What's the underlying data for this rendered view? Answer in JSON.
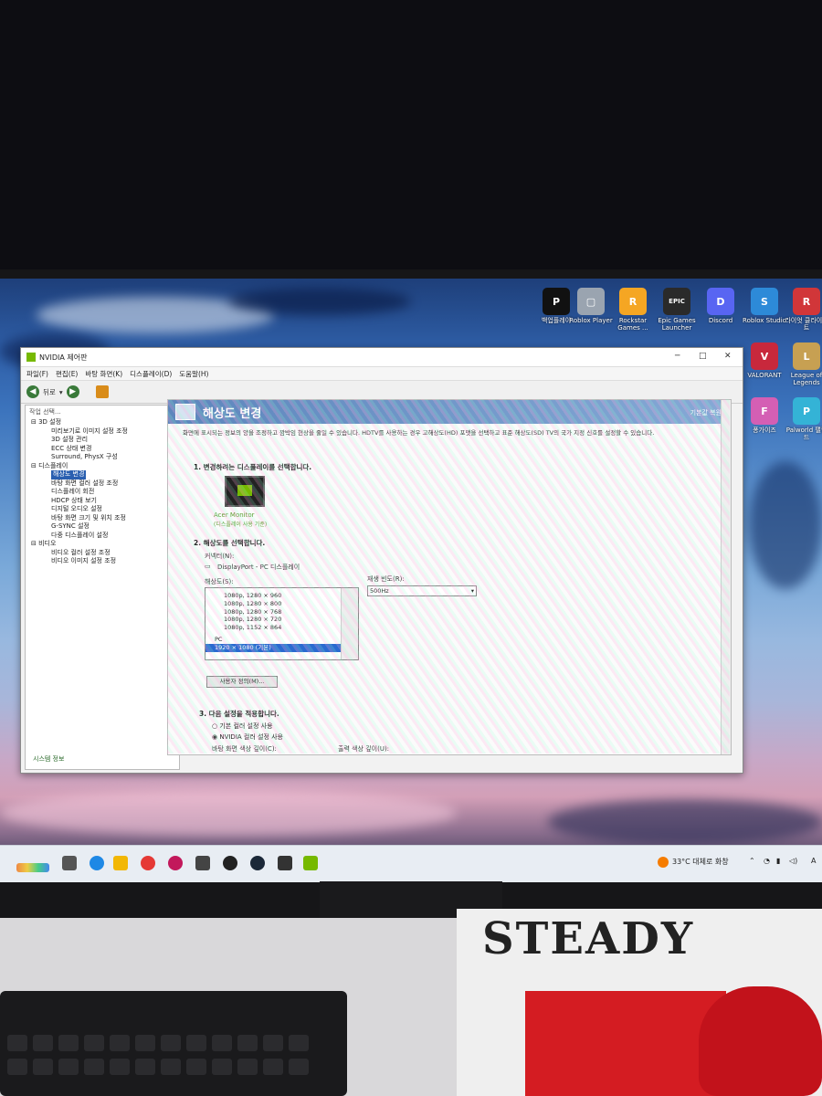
{
  "desktop_icons": [
    {
      "label": "백업플레이",
      "color": "#111111",
      "glyph": "P"
    },
    {
      "label": "Roblox Player",
      "color": "#9aa4b0",
      "glyph": "▢"
    },
    {
      "label": "Rockstar Games ...",
      "color": "#f5a623",
      "glyph": "R"
    },
    {
      "label": "Epic Games Launcher",
      "color": "#2a2a2a",
      "glyph": "EPIC"
    },
    {
      "label": "Discord",
      "color": "#5865f2",
      "glyph": "D"
    },
    {
      "label": "Roblox Studio",
      "color": "#2d8ad8",
      "glyph": "S"
    },
    {
      "label": "라이엇 클라이언트",
      "color": "#d13639",
      "glyph": "R"
    },
    {
      "label": "VALORANT",
      "color": "#c8283c",
      "glyph": "V"
    },
    {
      "label": "League of Legends",
      "color": "#c7a052",
      "glyph": "L"
    },
    {
      "label": "퐁가이즈",
      "color": "#d45fb4",
      "glyph": "F"
    },
    {
      "label": "Palworld 팰월드",
      "color": "#34b3d6",
      "glyph": "P"
    }
  ],
  "window": {
    "title": "NVIDIA 제어판",
    "menu": [
      "파일(F)",
      "편집(E)",
      "바탕 화면(K)",
      "디스플레이(D)",
      "도움말(H)"
    ],
    "back_label": "뒤로",
    "left_header": "작업 선택...",
    "tree": [
      {
        "type": "cat",
        "label": "3D 설정"
      },
      {
        "type": "item",
        "label": "미리보기로 이미지 설정 조정"
      },
      {
        "type": "item",
        "label": "3D 설정 관리"
      },
      {
        "type": "item",
        "label": "ECC 상태 변경"
      },
      {
        "type": "item",
        "label": "Surround, PhysX 구성"
      },
      {
        "type": "cat",
        "label": "디스플레이"
      },
      {
        "type": "item",
        "label": "해상도 변경",
        "selected": true
      },
      {
        "type": "item",
        "label": "바탕 화면 컬러 설정 조정"
      },
      {
        "type": "item",
        "label": "디스플레이 회전"
      },
      {
        "type": "item",
        "label": "HDCP 상태 보기"
      },
      {
        "type": "item",
        "label": "디지털 오디오 설정"
      },
      {
        "type": "item",
        "label": "바탕 화면 크기 및 위치 조정"
      },
      {
        "type": "item",
        "label": "G-SYNC 설정"
      },
      {
        "type": "item",
        "label": "다중 디스플레이 설정"
      },
      {
        "type": "cat",
        "label": "비디오"
      },
      {
        "type": "item",
        "label": "비디오 컬러 설정 조정"
      },
      {
        "type": "item",
        "label": "비디오 이미지 설정 조정"
      }
    ],
    "system_info": "시스템 정보",
    "page_title": "해상도 변경",
    "restore_defaults": "기본값 복원",
    "description": "화면에 표시되는 정보의 양을 조정하고 깜박임 현상을 줄일 수 있습니다. HDTV를 사용하는 경우 고해상도(HD) 포맷을 선택하고 표준 해상도(SD) TV의 국가 지정 신호를 설정할 수 있습니다.",
    "section1": "1. 변경하려는 디스플레이를 선택합니다.",
    "display_name": "Acer Monitor",
    "display_sub": "(디스플레이 사용 기준)",
    "section2": "2. 해상도를 선택합니다.",
    "connector_label": "커넥터(N):",
    "connector_value": "DisplayPort - PC 디스플레이",
    "resolution_label": "해상도(S):",
    "refresh_label": "재생 빈도(R):",
    "refresh_value": "500Hz",
    "resolutions": [
      "1080p, 1280 × 960",
      "1080p, 1280 × 800",
      "1080p, 1280 × 768",
      "1080p, 1280 × 720",
      "1080p, 1152 × 864"
    ],
    "pc_group": "PC",
    "selected_resolution": "1920 × 1080 (기본)",
    "customize_button": "사용자 정의(M)...",
    "section3": "3. 다음 설정을 적용합니다.",
    "radio1": "기본 컬러 설정 사용",
    "radio2": "NVIDIA 컬러 설정 사용",
    "color_depth_label": "바탕 화면 색상 깊이(C):",
    "output_depth_label": "출력 색상 깊이(U):"
  },
  "taskbar": {
    "weather": "33°C 대체로 화창",
    "lang": "A"
  },
  "poster_text": "STEADY"
}
